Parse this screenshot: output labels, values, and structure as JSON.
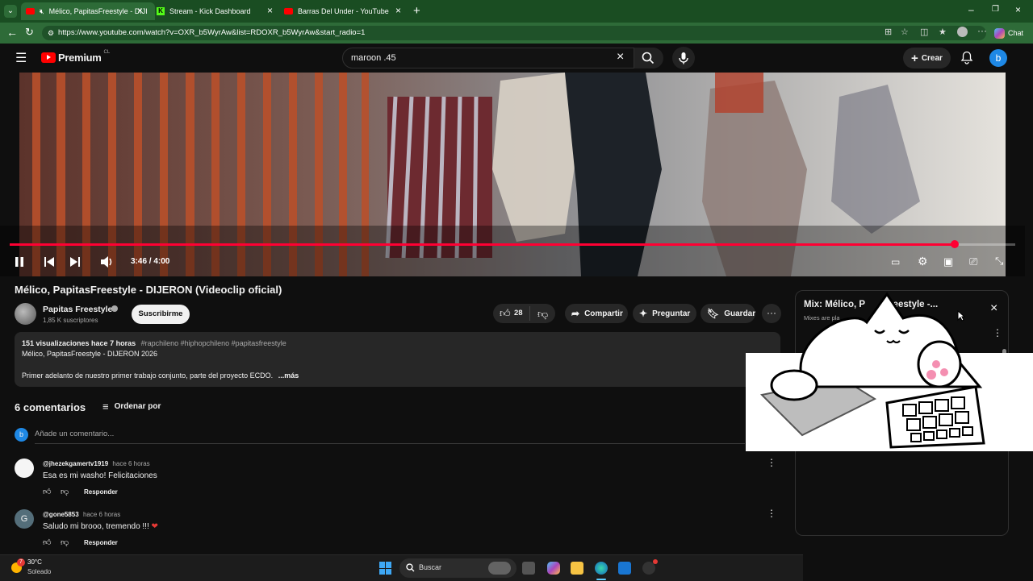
{
  "browser": {
    "tabs": [
      {
        "title": "Mélico, PapitasFreestyle - DIJI",
        "active": true
      },
      {
        "title": "Stream - Kick Dashboard",
        "active": false
      },
      {
        "title": "Barras Del Under - YouTube",
        "active": false
      }
    ],
    "url": "https://www.youtube.com/watch?v=OXR_b5WyrAw&list=RDOXR_b5WyrAw&start_radio=1",
    "chat_label": "Chat"
  },
  "youtube": {
    "logo_text": "Premium",
    "logo_region": "CL",
    "search_query": "maroon .45",
    "create_label": "Crear",
    "avatar_letter": "b"
  },
  "player": {
    "time": "3:46 / 4:00",
    "progress": 0.94
  },
  "video": {
    "title": "Mélico, PapitasFreestyle - DIJERON (Videoclip oficial)",
    "channel": "Papitas Freestyle",
    "subscribers": "1,85 K suscriptores",
    "subscribe_label": "Suscribirme",
    "likes": "28",
    "share_label": "Compartir",
    "ask_label": "Preguntar",
    "save_label": "Guardar"
  },
  "description": {
    "stats": "151 visualizaciones  hace 7 horas",
    "hashtags": "#rapchileno #hiphopchileno #papitasfreestyle",
    "line1": "Mélico, PapitasFreestyle - DIJERON 2026",
    "line2": "Primer adelanto de nuestro primer trabajo conjunto, parte del proyecto ECDO.",
    "more": "...más"
  },
  "comments": {
    "count_label": "6 comentarios",
    "sort_label": "Ordenar por",
    "add_placeholder": "Añade un comentario...",
    "user_letter": "b",
    "reply_label": "Responder",
    "items": [
      {
        "author": "@jhezekgamertv1919",
        "time": "hace 6 horas",
        "text": "Esa es mi washo! Felicitaciones",
        "avatar": ""
      },
      {
        "author": "@gone5853",
        "time": "hace 6 horas",
        "text": "Saludo mi brooo, tremendo !!! ",
        "avatar": "G"
      }
    ]
  },
  "mix": {
    "title": "Mix: Mélico, P",
    "title_tail": "Freestyle -...",
    "subtitle": "Mixes are pla"
  },
  "taskbar": {
    "temp": "30°C",
    "weather": "Soleado",
    "badge": "7",
    "search_label": "Buscar"
  }
}
